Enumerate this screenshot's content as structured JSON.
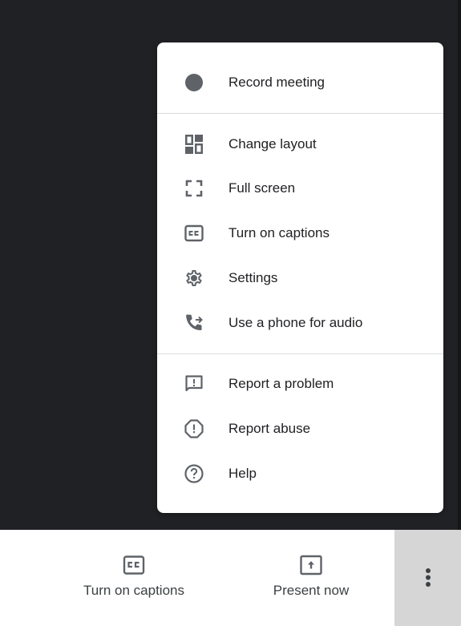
{
  "colors": {
    "background": "#202124",
    "menu_bg": "#ffffff",
    "icon": "#5f6368",
    "text": "#202124",
    "divider": "#dadce0",
    "bar_bg": "#ffffff",
    "more_button_bg": "#d6d6d6"
  },
  "menu": {
    "sections": [
      {
        "items": [
          {
            "label": "Record meeting",
            "icon": "record-dot-icon"
          }
        ]
      },
      {
        "items": [
          {
            "label": "Change layout",
            "icon": "layout-icon"
          },
          {
            "label": "Full screen",
            "icon": "fullscreen-icon"
          },
          {
            "label": "Turn on captions",
            "icon": "closed-captions-icon"
          },
          {
            "label": "Settings",
            "icon": "gear-icon"
          },
          {
            "label": "Use a phone for audio",
            "icon": "phone-forward-icon"
          }
        ]
      },
      {
        "items": [
          {
            "label": "Report a problem",
            "icon": "feedback-icon"
          },
          {
            "label": "Report abuse",
            "icon": "report-octagon-icon"
          },
          {
            "label": "Help",
            "icon": "help-circle-icon"
          }
        ]
      }
    ]
  },
  "bottom_bar": {
    "captions_button": {
      "label": "Turn on captions",
      "icon": "closed-captions-icon"
    },
    "present_button": {
      "label": "Present now",
      "icon": "present-screen-icon"
    },
    "more_button": {
      "icon": "more-vertical-icon"
    }
  }
}
